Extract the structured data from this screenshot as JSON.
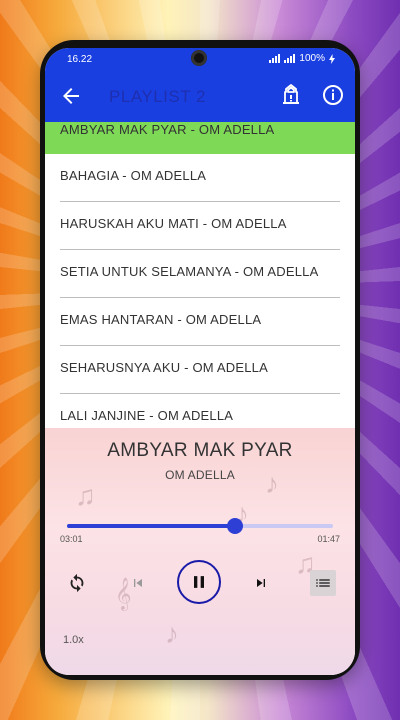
{
  "status_bar": {
    "time": "16.22",
    "battery": "100%"
  },
  "app_bar": {
    "title": "PLAYLIST 2",
    "back_icon": "arrow-back-icon",
    "alarm_icon": "alarm-lock-icon",
    "info_icon": "info-icon"
  },
  "playlist": {
    "items": [
      {
        "label": "AMBYAR MAK PYAR - OM ADELLA",
        "active": true
      },
      {
        "label": "BAHAGIA - OM ADELLA",
        "active": false
      },
      {
        "label": "HARUSKAH AKU MATI - OM ADELLA",
        "active": false
      },
      {
        "label": "SETIA UNTUK SELAMANYA - OM ADELLA",
        "active": false
      },
      {
        "label": "EMAS HANTARAN - OM ADELLA",
        "active": false
      },
      {
        "label": "SEHARUSNYA AKU - OM ADELLA",
        "active": false
      },
      {
        "label": "LALI JANJINE - OM ADELLA",
        "active": false
      }
    ]
  },
  "player": {
    "title": "AMBYAR MAK PYAR",
    "artist": "OM ADELLA",
    "elapsed": "03:01",
    "total": "01:47",
    "progress": 0.63,
    "speed": "1.0x",
    "icons": {
      "repeat": "repeat-icon",
      "previous": "skip-previous-icon",
      "play_pause": "pause-icon",
      "next": "skip-next-icon",
      "queue": "queue-list-icon"
    }
  },
  "colors": {
    "primary": "#1a3fe0",
    "active_row": "#7ed957",
    "seek": "#2e3fd6"
  }
}
